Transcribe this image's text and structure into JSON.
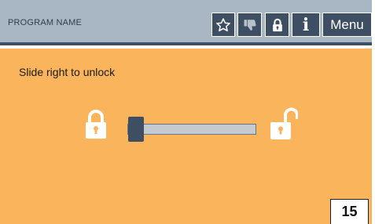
{
  "header": {
    "program_name": "PROGRAM NAME",
    "buttons": [
      {
        "id": "star",
        "icon": "star-outline-icon"
      },
      {
        "id": "thumb",
        "icon": "thumbs-down-icon"
      },
      {
        "id": "lock",
        "icon": "lock-icon"
      },
      {
        "id": "info",
        "icon": "info-icon",
        "label": "i"
      },
      {
        "id": "menu",
        "label": "Menu"
      }
    ]
  },
  "main": {
    "instruction": "Slide right to unlock",
    "left_icon": "lock-closed-icon",
    "right_icon": "lock-open-icon",
    "slider_position": 0
  },
  "page_number": "15",
  "colors": {
    "header_bg": "#a9b6c4",
    "header_dark": "#3e4f63",
    "main_bg": "#f9b45c",
    "track": "#c3cbd1",
    "white": "#ffffff"
  }
}
